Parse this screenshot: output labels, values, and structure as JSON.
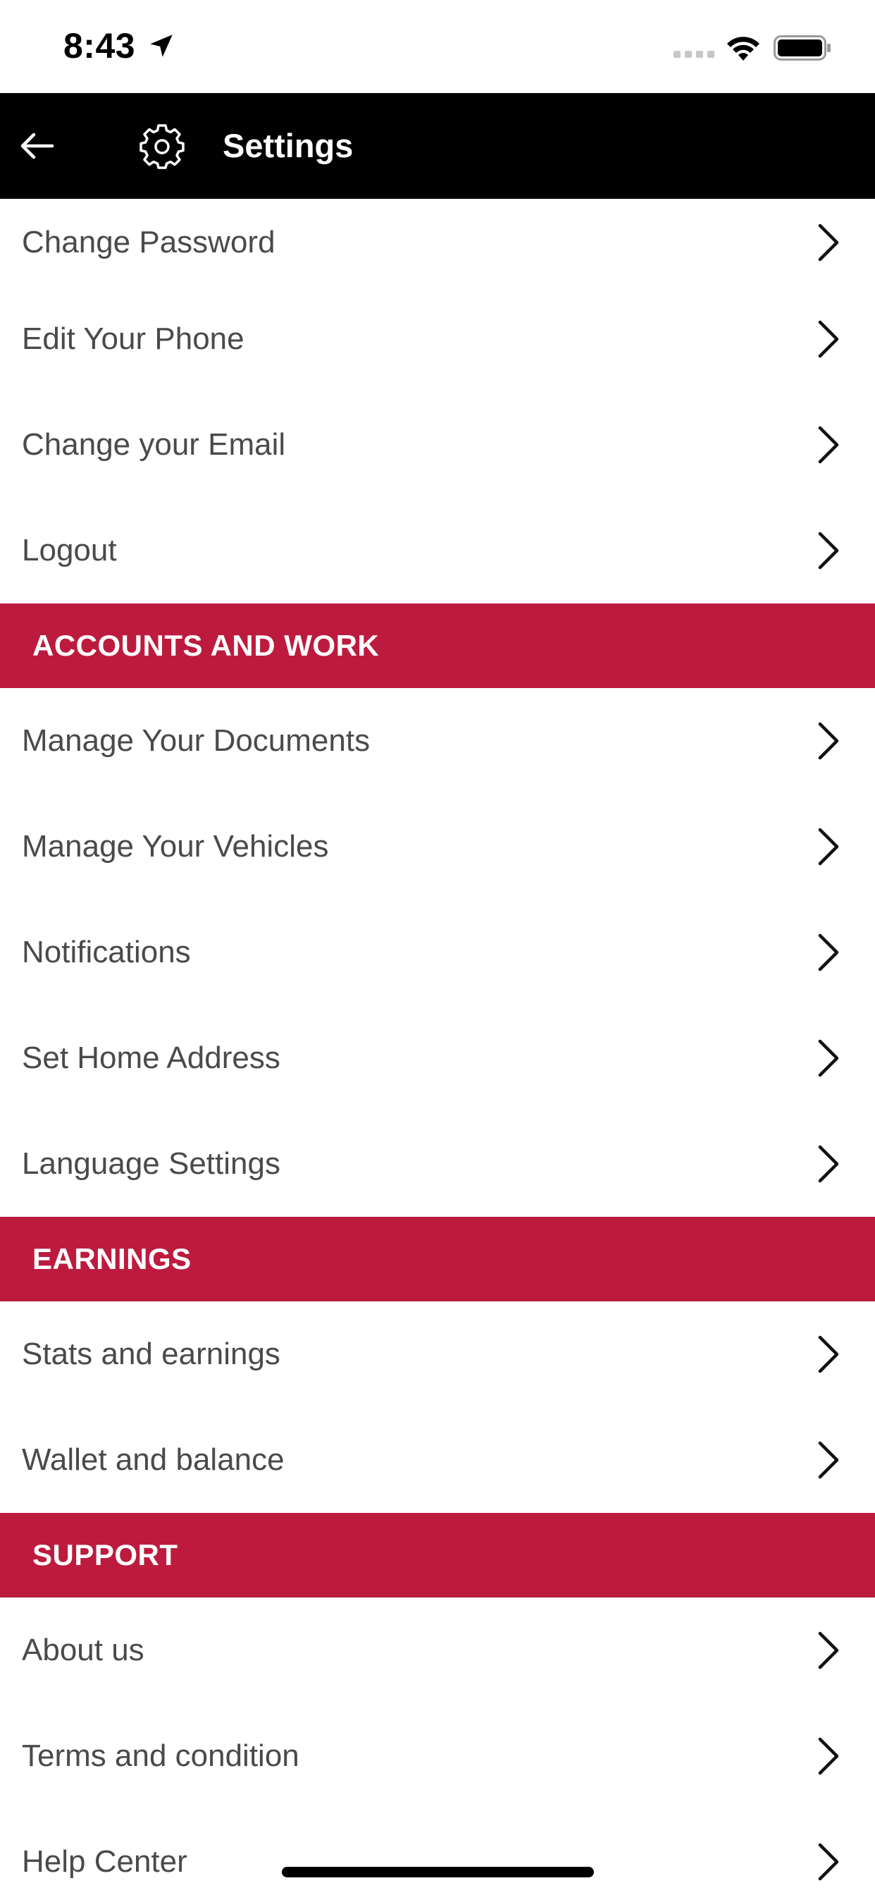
{
  "status_bar": {
    "time": "8:43"
  },
  "header": {
    "title": "Settings",
    "back_icon": "back-arrow-icon",
    "title_icon": "gear-icon"
  },
  "colors": {
    "header_bg": "#000000",
    "section_bg": "#bd1b3e",
    "row_text": "#4a4a4a"
  },
  "account_items": [
    {
      "label": "Change Password"
    },
    {
      "label": "Edit Your Phone"
    },
    {
      "label": "Change your Email"
    },
    {
      "label": "Logout"
    }
  ],
  "sections": [
    {
      "title": "ACCOUNTS AND WORK",
      "items": [
        {
          "label": "Manage Your Documents"
        },
        {
          "label": "Manage Your Vehicles"
        },
        {
          "label": "Notifications"
        },
        {
          "label": "Set Home Address"
        },
        {
          "label": "Language Settings"
        }
      ]
    },
    {
      "title": "EARNINGS",
      "items": [
        {
          "label": "Stats and earnings"
        },
        {
          "label": "Wallet and balance"
        }
      ]
    },
    {
      "title": "SUPPORT",
      "items": [
        {
          "label": "About us"
        },
        {
          "label": "Terms and condition"
        },
        {
          "label": "Help Center"
        }
      ]
    }
  ]
}
